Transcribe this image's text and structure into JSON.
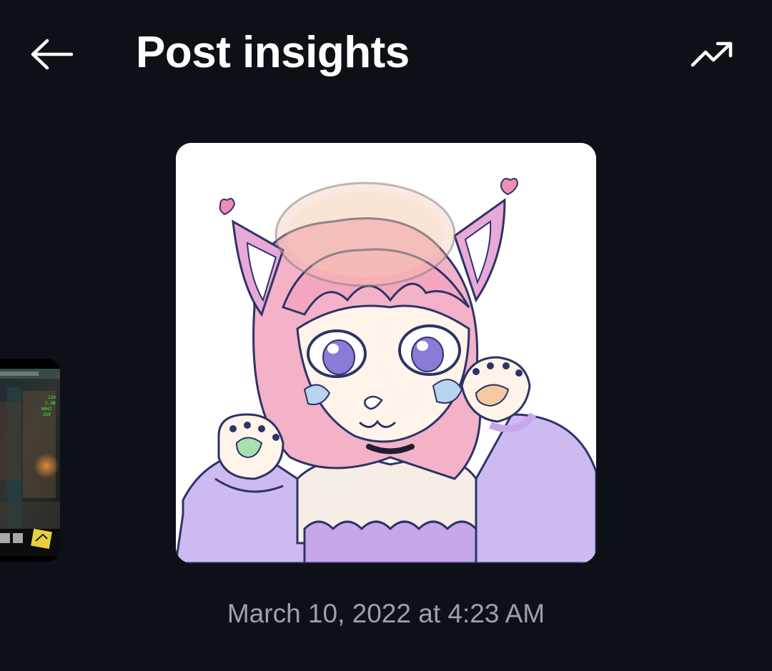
{
  "header": {
    "title": "Post insights",
    "back_icon": "arrow-left-icon",
    "trend_icon": "trending-up-icon"
  },
  "media": {
    "main_image": "anime catgirl drawing with pink hair and cat ears",
    "side_thumbnail": "game screenshot thumbnail"
  },
  "post": {
    "timestamp": "March 10, 2022 at 4:23 AM"
  },
  "colors": {
    "background": "#0d1117",
    "text": "#ffffff",
    "muted_text": "#9aa1a9"
  }
}
